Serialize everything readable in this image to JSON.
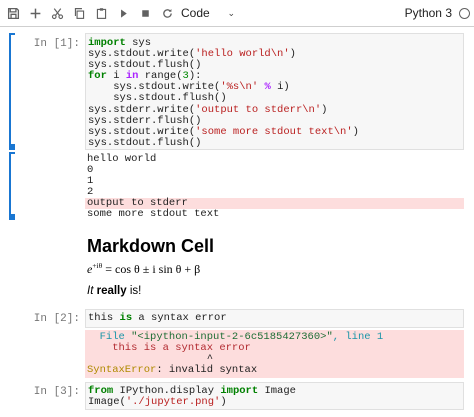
{
  "toolbar": {
    "buttons": [
      {
        "name": "save-icon"
      },
      {
        "name": "add-cell-icon"
      },
      {
        "name": "cut-icon"
      },
      {
        "name": "copy-icon"
      },
      {
        "name": "paste-icon"
      },
      {
        "name": "run-icon"
      },
      {
        "name": "stop-icon"
      },
      {
        "name": "restart-icon"
      }
    ],
    "cell_type": "Code",
    "kernel_name": "Python 3"
  },
  "cell1": {
    "prompt": "In [1]:",
    "code_lines": [
      "import sys",
      "sys.stdout.write('hello world\\n')",
      "sys.stdout.flush()",
      "for i in range(3):",
      "    sys.stdout.write('%s\\n' % i)",
      "    sys.stdout.flush()",
      "sys.stderr.write('output to stderr\\n')",
      "sys.stderr.flush()",
      "sys.stdout.write('some more stdout text\\n')",
      "sys.stdout.flush()"
    ],
    "outputs": [
      {
        "text": "hello world",
        "stream": "stdout"
      },
      {
        "text": "0",
        "stream": "stdout"
      },
      {
        "text": "1",
        "stream": "stdout"
      },
      {
        "text": "2",
        "stream": "stdout"
      },
      {
        "text": "output to stderr",
        "stream": "stderr"
      },
      {
        "text": "some more stdout text",
        "stream": "stdout"
      }
    ]
  },
  "markdown": {
    "heading": "Markdown Cell",
    "math_exp": "+iθ",
    "math_rest": " = cos θ ± i sin θ + β",
    "para_italic": "It",
    "para_bold": "really",
    "para_rest": " is!"
  },
  "cell2": {
    "prompt": "In [2]:",
    "code": "this is a syntax error",
    "error": {
      "file_prefix": "  File ",
      "file": "\"<ipython-input-2-6c5185427360>\"",
      "line_prefix": ", line ",
      "line_no": "1",
      "code": "    this is a syntax error",
      "caret": "                   ^",
      "error_name": "SyntaxError",
      "error_msg": ": invalid syntax"
    }
  },
  "cell3": {
    "prompt": "In [3]:",
    "code_line1_kw1": "from",
    "code_line1_mod": " IPython.display ",
    "code_line1_kw2": "import",
    "code_line1_rest": " Image",
    "code_line2_pre": "Image(",
    "code_line2_str": "'./jupyter.png'",
    "code_line2_post": ")"
  }
}
